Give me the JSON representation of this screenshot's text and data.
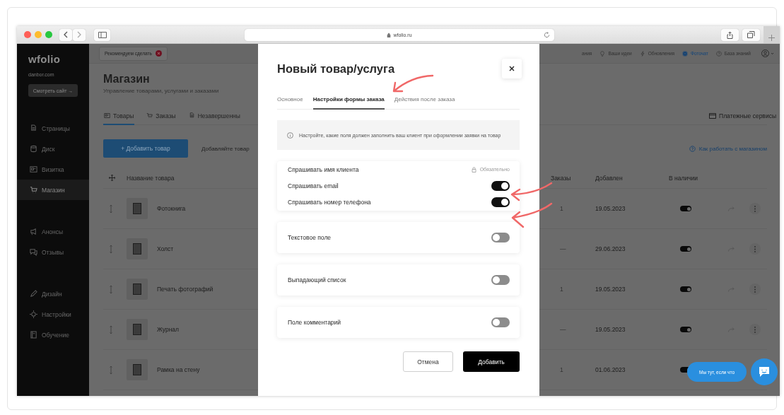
{
  "browser": {
    "address": "wfolio.ru"
  },
  "sidebar": {
    "logo": "wfolio",
    "domain": "danbor.com",
    "view_site": "Смотреть сайт →",
    "groups": [
      {
        "items": [
          {
            "label": "Страницы",
            "selected": false
          },
          {
            "label": "Диск",
            "selected": false
          },
          {
            "label": "Визитка",
            "selected": false
          },
          {
            "label": "Магазин",
            "selected": true
          }
        ]
      },
      {
        "items": [
          {
            "label": "Анонсы",
            "selected": false
          },
          {
            "label": "Отзывы",
            "selected": false
          }
        ]
      },
      {
        "items": [
          {
            "label": "Дизайн",
            "selected": false
          },
          {
            "label": "Настройки",
            "selected": false
          },
          {
            "label": "Обучение",
            "selected": false
          }
        ]
      }
    ]
  },
  "topbar": {
    "recommend": "Рекомендуем сделать",
    "links": [
      {
        "label": "ания",
        "highlighted": false
      },
      {
        "label": "Ваши идеи",
        "highlighted": false
      },
      {
        "label": "Обновления",
        "highlighted": false
      },
      {
        "label": "Фоточат",
        "highlighted": true
      },
      {
        "label": "База знаний",
        "highlighted": false
      }
    ]
  },
  "page": {
    "title": "Магазин",
    "subtitle": "Управление товарами, услугами и заказами",
    "tabs": [
      {
        "label": "Товары",
        "selected": true
      },
      {
        "label": "Заказы",
        "selected": false
      },
      {
        "label": "Незавершенны",
        "selected": false
      }
    ],
    "payment_link": "Платежные сервисы",
    "add_button": "+ Добавить товар",
    "hint": "Добавляйте товар",
    "help_link": "Как работать с магазином"
  },
  "table": {
    "columns": [
      "Название товара",
      "Заказы",
      "Добавлен",
      "В наличии"
    ],
    "rows": [
      {
        "name": "Фотокнига",
        "orders": "1",
        "added": "19.05.2023",
        "in_stock": true
      },
      {
        "name": "Холст",
        "orders": "—",
        "added": "29.06.2023",
        "in_stock": true
      },
      {
        "name": "Печать фотографий",
        "orders": "1",
        "added": "19.05.2023",
        "in_stock": true
      },
      {
        "name": "Журнал",
        "orders": "—",
        "added": "19.05.2023",
        "in_stock": true
      },
      {
        "name": "Рамка на стену",
        "orders": "1",
        "added": "01.06.2023",
        "in_stock": true
      }
    ]
  },
  "modal": {
    "title": "Новый товар/услуга",
    "tabs": [
      {
        "label": "Основное",
        "selected": false
      },
      {
        "label": "Настройки формы заказа",
        "selected": true
      },
      {
        "label": "Действия после заказа",
        "selected": false
      }
    ],
    "info": "Настройте, какие поля должен заполнить ваш клиент при оформлении заявки на товар",
    "groups": [
      {
        "fields": [
          {
            "label": "Спрашивать имя клиента",
            "kind": "required",
            "note": "Обязательно"
          },
          {
            "label": "Спрашивать email",
            "kind": "toggle",
            "on": true
          },
          {
            "label": "Спрашивать номер телефона",
            "kind": "toggle",
            "on": true
          }
        ]
      },
      {
        "fields": [
          {
            "label": "Текстовое поле",
            "kind": "toggle",
            "on": false
          }
        ]
      },
      {
        "fields": [
          {
            "label": "Выпадающий список",
            "kind": "toggle",
            "on": false
          }
        ]
      },
      {
        "fields": [
          {
            "label": "Поле комментарий",
            "kind": "toggle",
            "on": false
          }
        ]
      }
    ],
    "buttons": [
      {
        "label": "Отмена",
        "kind": "secondary"
      },
      {
        "label": "Добавить",
        "kind": "primary"
      }
    ]
  },
  "chat": {
    "bubble": "Мы тут, если что"
  }
}
